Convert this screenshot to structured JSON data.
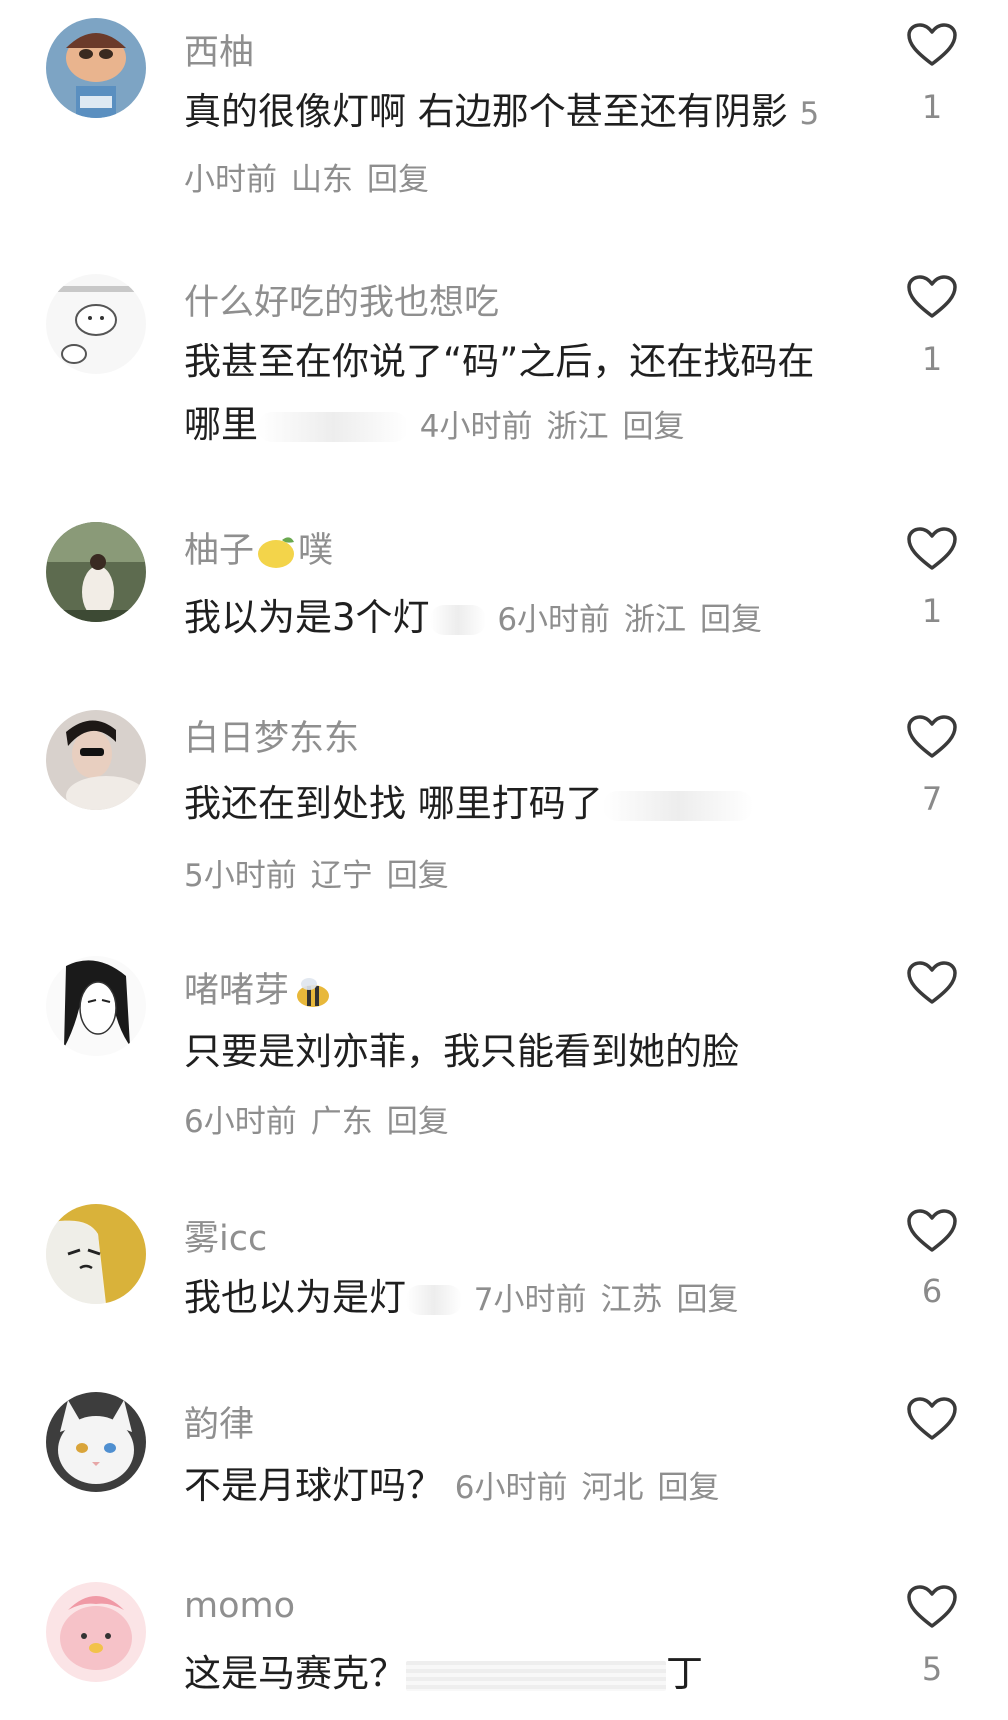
{
  "comments": [
    {
      "user": "西柚",
      "text": "真的很像灯啊 右边那个甚至还有阴影",
      "time": "5小时前",
      "region": "山东",
      "reply": "回复",
      "likes": "1"
    },
    {
      "user": "什么好吃的我也想吃",
      "text": "我甚至在你说了“码”之后，还在找码在哪里",
      "time": "4小时前",
      "region": "浙江",
      "reply": "回复",
      "likes": "1"
    },
    {
      "user_a": "柚子",
      "user_b": "噗",
      "text": "我以为是3个灯",
      "time": "6小时前",
      "region": "浙江",
      "reply": "回复",
      "likes": "1"
    },
    {
      "user": "白日梦东东",
      "text": "我还在到处找 哪里打码了",
      "time": "5小时前",
      "region": "辽宁",
      "reply": "回复",
      "likes": "7"
    },
    {
      "user": "啫啫芽",
      "text": "只要是刘亦菲，我只能看到她的脸",
      "time": "6小时前",
      "region": "广东",
      "reply": "回复",
      "likes": ""
    },
    {
      "user": "雾icc",
      "text": "我也以为是灯",
      "time": "7小时前",
      "region": "江苏",
      "reply": "回复",
      "likes": "6"
    },
    {
      "user": "韵律",
      "text": "不是月球灯吗？",
      "time": "6小时前",
      "region": "河北",
      "reply": "回复",
      "likes": ""
    },
    {
      "user": "momo",
      "text": "这是马赛克？",
      "text_tail": "丁",
      "likes": "5"
    }
  ],
  "icons": {
    "like": "heart-outline-icon"
  },
  "colors": {
    "username": "#8f8f8f",
    "text": "#1f1f1f",
    "meta": "#8e8e8e"
  }
}
